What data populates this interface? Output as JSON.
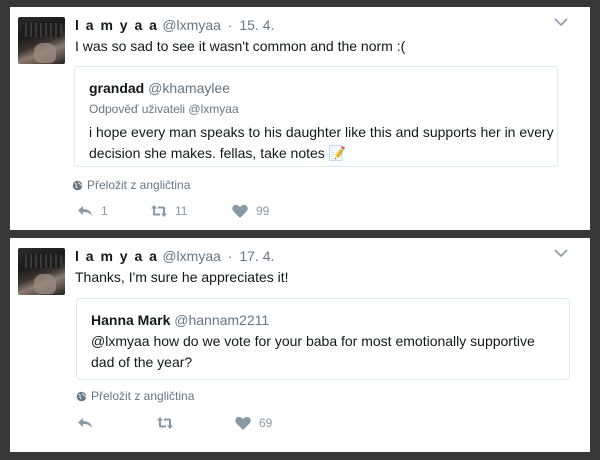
{
  "tweets": [
    {
      "author_name": "l a m y a a",
      "author_handle": "@lxmyaa",
      "date": "15. 4.",
      "text": "I was so sad to see it wasn't common and the norm :(",
      "quote": {
        "name": "grandad",
        "handle": "@khamaylee",
        "reply_context": "Odpověď uživateli @lxmyaa",
        "text": "i hope every man speaks to his daughter like this and supports her in every decision she makes. fellas, take notes 📝"
      },
      "translate_label": "Přeložit z angličtina",
      "reply_count": "1",
      "retweet_count": "11",
      "like_count": "99"
    },
    {
      "author_name": "l a m y a a",
      "author_handle": "@lxmyaa",
      "date": "17. 4.",
      "text": "Thanks, I'm sure he appreciates it!",
      "quote": {
        "name": "Hanna Mark",
        "handle": "@hannam2211",
        "text": "@lxmyaa how do we vote for your baba for most emotionally supportive dad of the year?"
      },
      "translate_label": "Přeložit z angličtina",
      "reply_count": "",
      "retweet_count": "",
      "like_count": "69"
    }
  ],
  "icons": {
    "reply": "reply-icon",
    "retweet": "retweet-icon",
    "like": "heart-icon",
    "translate": "globe-icon",
    "menu": "chevron-down-icon"
  },
  "colors": {
    "background": "#383838",
    "card": "#ffffff",
    "muted_text": "#657786",
    "icon_gray": "#8899a6",
    "border": "#e1e8ed"
  }
}
